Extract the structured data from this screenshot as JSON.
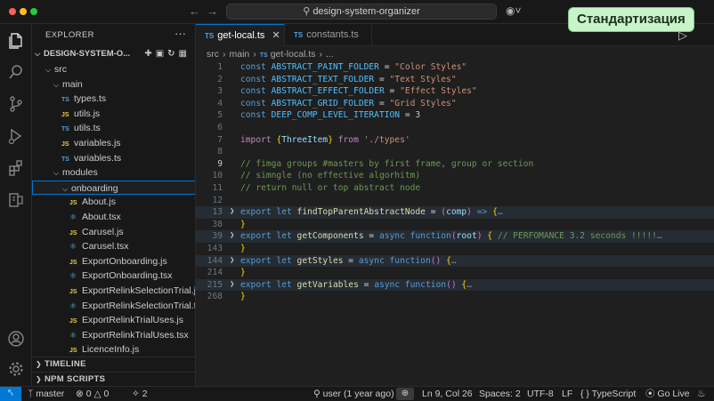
{
  "window": {
    "search_text": "design-system-organizer"
  },
  "badge": {
    "text": "Стандартизация"
  },
  "sidebar": {
    "header": "EXPLORER",
    "project": "DESIGN-SYSTEM-O...",
    "tree": [
      {
        "label": "src",
        "type": "folder",
        "indent": 1
      },
      {
        "label": "main",
        "type": "folder",
        "indent": 2
      },
      {
        "label": "types.ts",
        "type": "ts",
        "indent": 3
      },
      {
        "label": "utils.js",
        "type": "js",
        "indent": 3
      },
      {
        "label": "utils.ts",
        "type": "ts",
        "indent": 3
      },
      {
        "label": "variables.js",
        "type": "js",
        "indent": 3
      },
      {
        "label": "variables.ts",
        "type": "ts",
        "indent": 3
      },
      {
        "label": "modules",
        "type": "folder",
        "indent": 2
      },
      {
        "label": "onboarding",
        "type": "folder",
        "indent": 3,
        "selected": true
      },
      {
        "label": "About.js",
        "type": "js",
        "indent": 4
      },
      {
        "label": "About.tsx",
        "type": "tsx",
        "indent": 4
      },
      {
        "label": "Carusel.js",
        "type": "js",
        "indent": 4
      },
      {
        "label": "Carusel.tsx",
        "type": "tsx",
        "indent": 4
      },
      {
        "label": "ExportOnboarding.js",
        "type": "js",
        "indent": 4
      },
      {
        "label": "ExportOnboarding.tsx",
        "type": "tsx",
        "indent": 4
      },
      {
        "label": "ExportRelinkSelectionTrial.js",
        "type": "js",
        "indent": 4
      },
      {
        "label": "ExportRelinkSelectionTrial.tsx",
        "type": "tsx",
        "indent": 4
      },
      {
        "label": "ExportRelinkTrialUses.js",
        "type": "js",
        "indent": 4
      },
      {
        "label": "ExportRelinkTrialUses.tsx",
        "type": "tsx",
        "indent": 4
      },
      {
        "label": "LicenceInfo.js",
        "type": "js",
        "indent": 4
      }
    ],
    "sections": [
      "TIMELINE",
      "NPM SCRIPTS"
    ]
  },
  "tabs": [
    {
      "label": "get-local.ts",
      "active": true
    },
    {
      "label": "constants.ts",
      "active": false
    }
  ],
  "breadcrumb": {
    "parts": [
      "src",
      "main",
      "get-local.ts",
      "..."
    ]
  },
  "code": [
    {
      "ln": "1",
      "tokens": [
        [
          "kw",
          "const "
        ],
        [
          "var",
          "ABSTRACT_PAINT_FOLDER"
        ],
        [
          "op",
          " = "
        ],
        [
          "str",
          "\"Color Styles\""
        ]
      ]
    },
    {
      "ln": "2",
      "tokens": [
        [
          "kw",
          "const "
        ],
        [
          "var",
          "ABSTRACT_TEXT_FOLDER"
        ],
        [
          "op",
          " = "
        ],
        [
          "str",
          "\"Text Styles\""
        ]
      ]
    },
    {
      "ln": "3",
      "tokens": [
        [
          "kw",
          "const "
        ],
        [
          "var",
          "ABSTRACT_EFFECT_FOLDER"
        ],
        [
          "op",
          " = "
        ],
        [
          "str",
          "\"Effect Styles\""
        ]
      ]
    },
    {
      "ln": "4",
      "tokens": [
        [
          "kw",
          "const "
        ],
        [
          "var",
          "ABSTRACT_GRID_FOLDER"
        ],
        [
          "op",
          " = "
        ],
        [
          "str",
          "\"Grid Styles\""
        ]
      ]
    },
    {
      "ln": "5",
      "tokens": [
        [
          "kw",
          "const "
        ],
        [
          "var",
          "DEEP_COMP_LEVEL_ITERATION"
        ],
        [
          "op",
          " = "
        ],
        [
          "num",
          "3"
        ]
      ]
    },
    {
      "ln": "6",
      "tokens": []
    },
    {
      "ln": "7",
      "tokens": [
        [
          "kw2",
          "import "
        ],
        [
          "brace",
          "{"
        ],
        [
          "id",
          "ThreeItem"
        ],
        [
          "brace",
          "}"
        ],
        [
          "kw2",
          " from "
        ],
        [
          "str",
          "'./types'"
        ]
      ]
    },
    {
      "ln": "8",
      "tokens": []
    },
    {
      "ln": "9",
      "tokens": [
        [
          "cm",
          "// fimga groups #masters by first frame, group or section"
        ]
      ],
      "current": true
    },
    {
      "ln": "10",
      "tokens": [
        [
          "cm",
          "// simngle (no effective algorhitm)"
        ]
      ]
    },
    {
      "ln": "11",
      "tokens": [
        [
          "cm",
          "// return null or top abstract node"
        ]
      ]
    },
    {
      "ln": "12",
      "tokens": []
    },
    {
      "ln": "13",
      "tokens": [
        [
          "kw",
          "export "
        ],
        [
          "kw",
          "let "
        ],
        [
          "fn",
          "findTopParentAbstractNode"
        ],
        [
          "op",
          " = "
        ],
        [
          "brace2",
          "("
        ],
        [
          "id",
          "comp"
        ],
        [
          "brace2",
          ")"
        ],
        [
          "kw",
          " => "
        ],
        [
          "brace",
          "{"
        ],
        [
          "ell",
          "…"
        ]
      ],
      "fold": true,
      "hl": true
    },
    {
      "ln": "38",
      "tokens": [
        [
          "brace",
          "}"
        ]
      ]
    },
    {
      "ln": "39",
      "tokens": [
        [
          "kw",
          "export "
        ],
        [
          "kw",
          "let "
        ],
        [
          "fn",
          "getComponents"
        ],
        [
          "op",
          " = "
        ],
        [
          "kw",
          "async "
        ],
        [
          "kw",
          "function"
        ],
        [
          "brace2",
          "("
        ],
        [
          "id",
          "root"
        ],
        [
          "brace2",
          ")"
        ],
        [
          "op",
          " "
        ],
        [
          "brace",
          "{"
        ],
        [
          "cm",
          " // PERFOMANCE 3.2 seconds !!!!!"
        ],
        [
          "ell",
          "…"
        ]
      ],
      "fold": true,
      "hl": true
    },
    {
      "ln": "143",
      "tokens": [
        [
          "brace",
          "}"
        ]
      ]
    },
    {
      "ln": "144",
      "tokens": [
        [
          "kw",
          "export "
        ],
        [
          "kw",
          "let "
        ],
        [
          "fn",
          "getStyles"
        ],
        [
          "op",
          " = "
        ],
        [
          "kw",
          "async "
        ],
        [
          "kw",
          "function"
        ],
        [
          "brace2",
          "()"
        ],
        [
          "op",
          " "
        ],
        [
          "brace",
          "{"
        ],
        [
          "ell",
          "…"
        ]
      ],
      "fold": true,
      "hl": true
    },
    {
      "ln": "214",
      "tokens": [
        [
          "brace",
          "}"
        ]
      ]
    },
    {
      "ln": "215",
      "tokens": [
        [
          "kw",
          "export "
        ],
        [
          "kw",
          "let "
        ],
        [
          "fn",
          "getVariables"
        ],
        [
          "op",
          " = "
        ],
        [
          "kw",
          "async "
        ],
        [
          "kw",
          "function"
        ],
        [
          "brace2",
          "()"
        ],
        [
          "op",
          " "
        ],
        [
          "brace",
          "{"
        ],
        [
          "ell",
          "…"
        ]
      ],
      "fold": true,
      "hl": true
    },
    {
      "ln": "268",
      "tokens": [
        [
          "brace",
          "}"
        ]
      ]
    }
  ],
  "statusbar": {
    "branch": "master",
    "errors": "0",
    "warnings": "0",
    "ports": "2",
    "blame": "user (1 year ago)",
    "position": "Ln 9, Col 26",
    "spaces": "Spaces: 2",
    "encoding": "UTF-8",
    "eol": "LF",
    "language": "TypeScript",
    "golive": "Go Live"
  }
}
